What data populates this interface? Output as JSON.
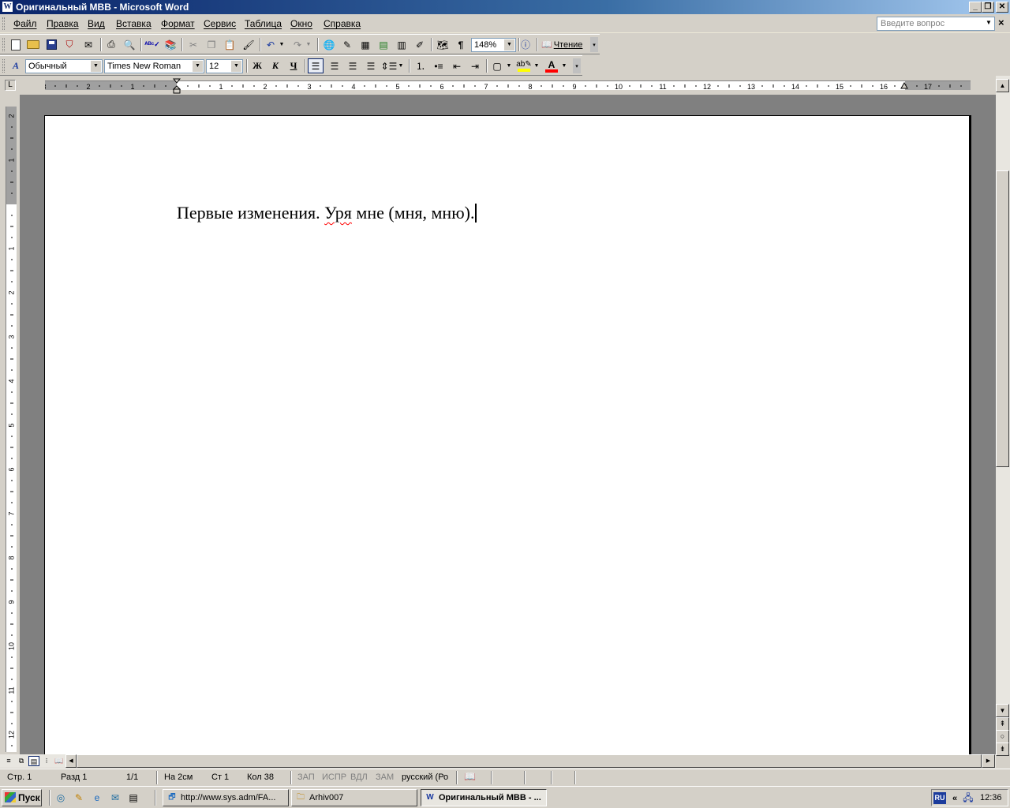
{
  "window": {
    "title": "Оригинальный МВВ - Microsoft Word",
    "app_icon": "W",
    "minimize_icon": "minimize-icon",
    "maximize_icon": "restore-icon",
    "close_icon": "close-icon"
  },
  "menu": {
    "items": [
      "Файл",
      "Правка",
      "Вид",
      "Вставка",
      "Формат",
      "Сервис",
      "Таблица",
      "Окно",
      "Справка"
    ],
    "help_placeholder": "Введите вопрос"
  },
  "standard_toolbar": {
    "zoom": "148%",
    "read_label": "Чтение"
  },
  "format_toolbar": {
    "style": "Обычный",
    "font": "Times New Roman",
    "size": "12",
    "bold": "Ж",
    "italic": "К",
    "underline": "Ч",
    "font_color": "A",
    "highlight_color": "#ffff00",
    "font_color_value": "#ff0000"
  },
  "document": {
    "text_before": "Первые изменения. ",
    "misspelled": "Уря",
    "text_after": " мне (мня, мню)."
  },
  "ruler": {
    "h_numbers": [
      "3",
      "2",
      "1",
      "1",
      "2",
      "3",
      "4",
      "5",
      "6",
      "7",
      "8",
      "9",
      "10",
      "11",
      "12",
      "13",
      "14",
      "15",
      "16",
      "17"
    ],
    "v_numbers": [
      "2",
      "1",
      "1",
      "2",
      "3",
      "4",
      "5",
      "6",
      "7",
      "8",
      "9",
      "10",
      "11",
      "12"
    ]
  },
  "status": {
    "page": "Стр. 1",
    "section": "Разд 1",
    "pages": "1/1",
    "at": "На 2см",
    "line": "Ст 1",
    "col": "Кол 38",
    "rec": "ЗАП",
    "trk": "ИСПР",
    "ext": "ВДЛ",
    "ovr": "ЗАМ",
    "language": "русский (Ро"
  },
  "taskbar": {
    "start": "Пуск",
    "tasks": [
      "http://www.sys.adm/FA...",
      "Arhiv007",
      "Оригинальный МВВ - ..."
    ],
    "lang": "RU",
    "time": "12:36"
  }
}
